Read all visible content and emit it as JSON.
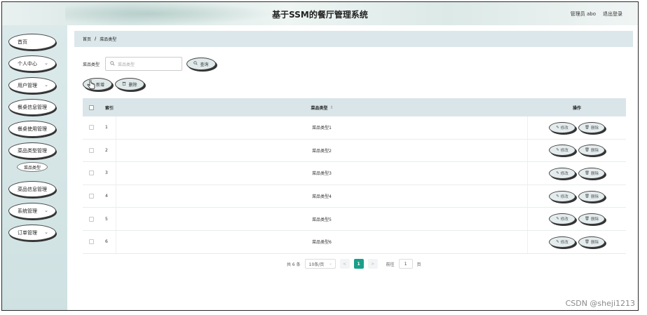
{
  "header": {
    "title": "基于SSM的餐厅管理系统",
    "user": "管理员 abo",
    "logout": "退出登录"
  },
  "sidebar": {
    "items": [
      {
        "label": "首页",
        "has_chevron": false
      },
      {
        "label": "个人中心",
        "has_chevron": true
      },
      {
        "label": "用户管理",
        "has_chevron": true
      },
      {
        "label": "餐桌信息管理",
        "has_chevron": false
      },
      {
        "label": "餐桌使用管理",
        "has_chevron": false
      },
      {
        "label": "菜品类型管理",
        "has_chevron": false
      },
      {
        "label": "菜品信息管理",
        "has_chevron": false
      },
      {
        "label": "系统管理",
        "has_chevron": true
      },
      {
        "label": "订单管理",
        "has_chevron": true
      }
    ],
    "active_sub": "菜品类型",
    "chevron": "⌄"
  },
  "breadcrumb": {
    "home": "首页",
    "separator": "/",
    "current": "菜品类型"
  },
  "search": {
    "label": "菜品类型",
    "placeholder": "菜品类型",
    "button": "查询",
    "search_icon": "search-icon"
  },
  "actions": {
    "add": "新增",
    "delete": "删除"
  },
  "table": {
    "headers": {
      "index": "索引",
      "name": "菜品类型",
      "sort": "⇕",
      "ops": "操作"
    },
    "rows": [
      {
        "index": "1",
        "name": "菜品类型1"
      },
      {
        "index": "2",
        "name": "菜品类型2"
      },
      {
        "index": "3",
        "name": "菜品类型3"
      },
      {
        "index": "4",
        "name": "菜品类型4"
      },
      {
        "index": "5",
        "name": "菜品类型5"
      },
      {
        "index": "6",
        "name": "菜品类型6"
      }
    ],
    "edit_label": "修改",
    "delete_label": "删除"
  },
  "pager": {
    "total": "共 6 条",
    "page_size": "10条/页",
    "prev": "<",
    "current": "1",
    "next": ">",
    "goto_label": "前往",
    "goto_value": "1",
    "page_unit": "页"
  },
  "watermark": "CSDN @sheji1213",
  "colors": {
    "accent": "#1aa088",
    "sidebar_bg": "#d3e4e5",
    "table_header_bg": "#d9e5e9"
  }
}
